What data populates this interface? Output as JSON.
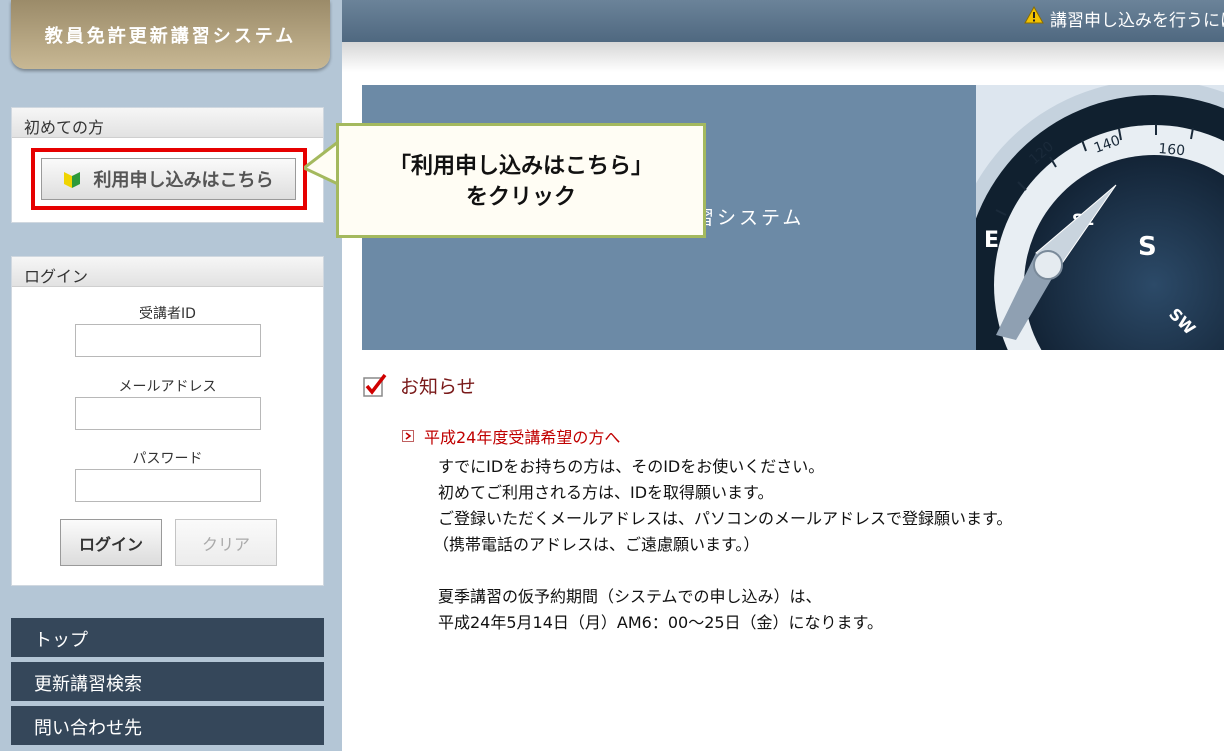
{
  "header": {
    "notice": "講習申し込みを行うには"
  },
  "sidebar": {
    "logo": "教員免許更新講習システム",
    "first_time": {
      "title": "初めての方",
      "register_label": "利用申し込みはこちら"
    },
    "login": {
      "title": "ログイン",
      "id_label": "受講者ID",
      "email_label": "メールアドレス",
      "password_label": "パスワード",
      "login_button": "ログイン",
      "clear_button": "クリア"
    },
    "nav": [
      {
        "label": "トップ"
      },
      {
        "label": "更新講習検索"
      },
      {
        "label": "問い合わせ先"
      }
    ]
  },
  "banner": {
    "title_partial": "習システム",
    "compass_labels": [
      "120",
      "140",
      "160",
      "SE",
      "E",
      "S",
      "SW"
    ]
  },
  "callout": {
    "line1": "「利用申し込みはこちら」",
    "line2": "をクリック"
  },
  "news": {
    "heading": "お知らせ",
    "item_title": "平成24年度受講希望の方へ",
    "lines": [
      "すでにIDをお持ちの方は、そのIDをお使いください。",
      "初めてご利用される方は、IDを取得願います。",
      "ご登録いただくメールアドレスは、パソコンのメールアドレスで登録願います。",
      "（携帯電話のアドレスは、ご遠慮願います。）",
      "",
      "夏季講習の仮予約期間（システムでの申し込み）は、",
      "平成24年5月14日（月）AM6：00～25日（金）になります。"
    ]
  },
  "colors": {
    "topbar": "#4f6880",
    "sidebar": "#b4c6d6",
    "nav": "#35475a",
    "highlight": "#e60000",
    "news_title": "#c00000",
    "callout_border": "#a4b95e"
  },
  "icons": {
    "warning": "warning-icon",
    "register": "beginner-leaf-icon",
    "news": "checkbox-checked-icon",
    "bullet": "arrow-bullet-icon"
  }
}
